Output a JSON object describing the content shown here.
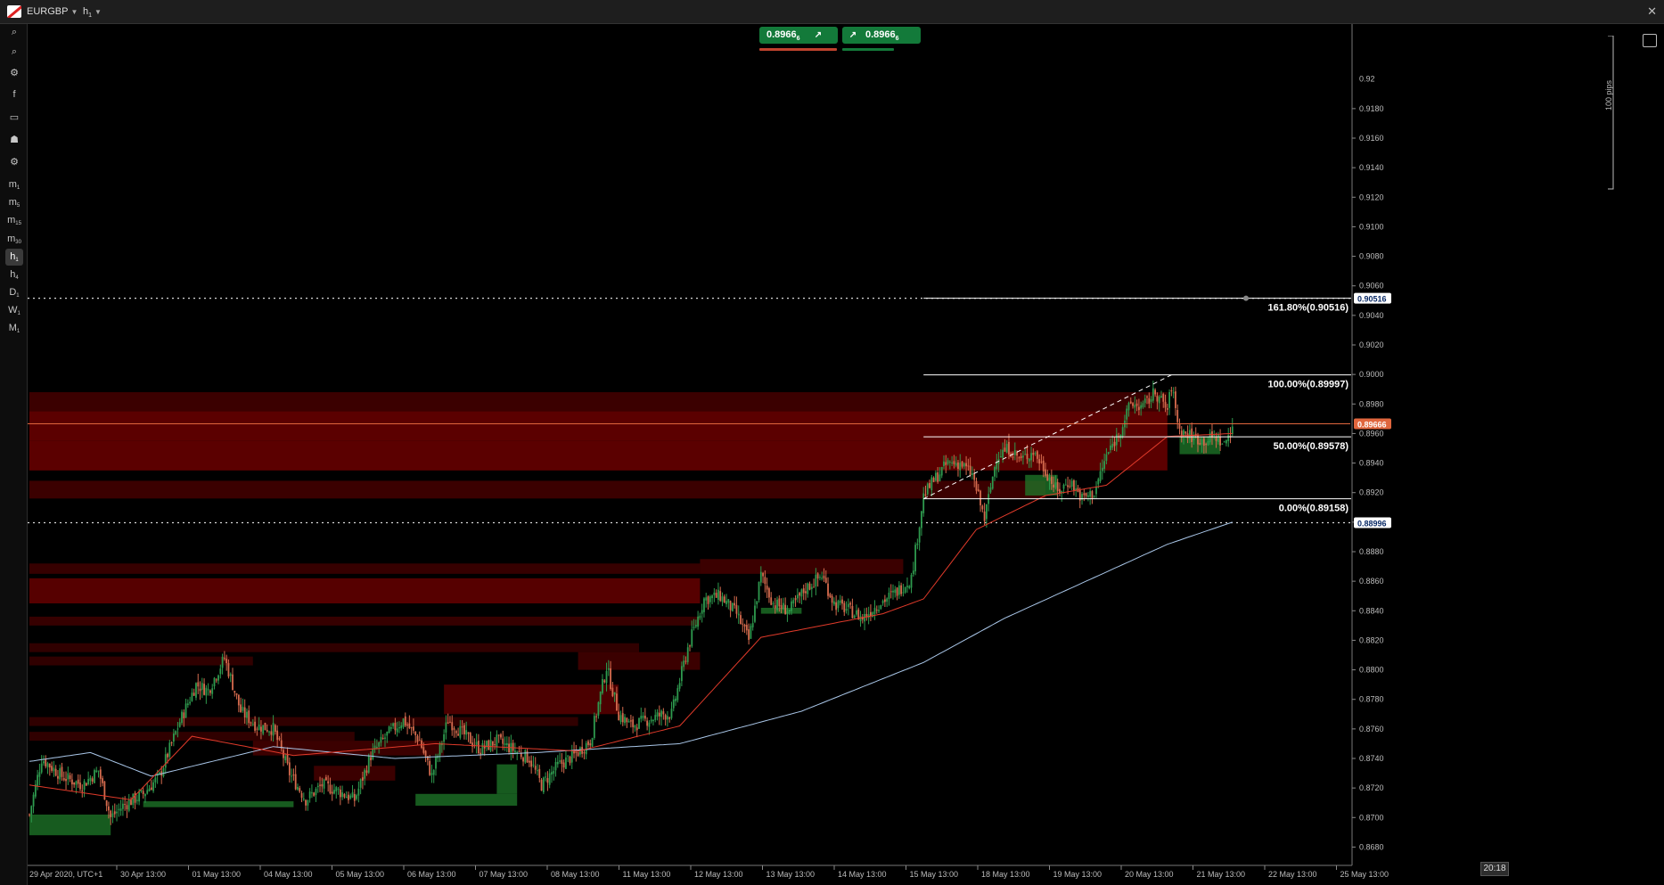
{
  "header": {
    "symbol": "EURGBP",
    "timeframe": "h",
    "timeframe_sub": "1"
  },
  "trade": {
    "sell_price": "0.8966",
    "buy_price": "0.8966",
    "sell_suffix": "6",
    "buy_suffix": "6"
  },
  "toolbar": [
    {
      "name": "zoom-in-icon",
      "label": "⌕",
      "sub": ""
    },
    {
      "name": "zoom-out-icon",
      "label": "⌕",
      "sub": ""
    },
    {
      "name": "indicators-icon",
      "label": "⚙",
      "sub": ""
    },
    {
      "name": "facebook-icon",
      "label": "f",
      "sub": ""
    },
    {
      "name": "chart-type-icon",
      "label": "▭",
      "sub": ""
    },
    {
      "name": "traders-icon",
      "label": "☗",
      "sub": ""
    },
    {
      "name": "settings-icon",
      "label": "⚙",
      "sub": ""
    },
    {
      "name": "tf-m1",
      "label": "m",
      "sub": "1"
    },
    {
      "name": "tf-m5",
      "label": "m",
      "sub": "5"
    },
    {
      "name": "tf-m15",
      "label": "m",
      "sub": "15"
    },
    {
      "name": "tf-m30",
      "label": "m",
      "sub": "30"
    },
    {
      "name": "tf-h1",
      "label": "h",
      "sub": "1",
      "selected": true
    },
    {
      "name": "tf-h4",
      "label": "h",
      "sub": "4"
    },
    {
      "name": "tf-d1",
      "label": "D",
      "sub": "1"
    },
    {
      "name": "tf-w1",
      "label": "W",
      "sub": "1"
    },
    {
      "name": "tf-mn1",
      "label": "M",
      "sub": "1"
    }
  ],
  "time_badge": "20:18",
  "pips_label": "100 pips",
  "colors": {
    "bull": "#2e9a4e",
    "bear": "#d56b4e",
    "ema": "#e03a2a",
    "sma": "#a9c6e8",
    "zone": "#6b0000",
    "accent_green": "#137a3a"
  },
  "chart_data": {
    "type": "candlestick",
    "symbol": "EURGBP",
    "ylim": [
      0.867,
      0.923
    ],
    "y_ticks": [
      "0.9180",
      "0.9160",
      "0.9140",
      "0.9120",
      "0.9100",
      "0.9080",
      "0.9060",
      "0.9040",
      "0.9020",
      "0.9000",
      "0.8980",
      "0.8960",
      "0.8940",
      "0.8920",
      "0.8900",
      "0.8880",
      "0.8860",
      "0.8840",
      "0.8820",
      "0.8800",
      "0.8780",
      "0.8760",
      "0.8740",
      "0.8720",
      "0.8700",
      "0.8680"
    ],
    "y_top_partial": "0.92",
    "x_labels": [
      "29 Apr 2020, UTC+1",
      "30 Apr 13:00",
      "01 May 13:00",
      "04 May 13:00",
      "05 May 13:00",
      "06 May 13:00",
      "07 May 13:00",
      "08 May 13:00",
      "11 May 13:00",
      "12 May 13:00",
      "13 May 13:00",
      "14 May 13:00",
      "15 May 13:00",
      "18 May 13:00",
      "19 May 13:00",
      "20 May 13:00",
      "21 May 13:00",
      "22 May 13:00",
      "25 May 13:00"
    ],
    "close_keypoints": [
      [
        0,
        0.8702
      ],
      [
        6,
        0.874
      ],
      [
        16,
        0.8728
      ],
      [
        26,
        0.8722
      ],
      [
        34,
        0.8732
      ],
      [
        40,
        0.87
      ],
      [
        46,
        0.8708
      ],
      [
        56,
        0.8716
      ],
      [
        64,
        0.8728
      ],
      [
        74,
        0.8765
      ],
      [
        82,
        0.879
      ],
      [
        88,
        0.8786
      ],
      [
        96,
        0.8808
      ],
      [
        104,
        0.8772
      ],
      [
        112,
        0.8762
      ],
      [
        120,
        0.876
      ],
      [
        128,
        0.873
      ],
      [
        136,
        0.8712
      ],
      [
        144,
        0.8722
      ],
      [
        152,
        0.8718
      ],
      [
        160,
        0.8712
      ],
      [
        168,
        0.8742
      ],
      [
        176,
        0.8756
      ],
      [
        184,
        0.8766
      ],
      [
        192,
        0.8752
      ],
      [
        198,
        0.8728
      ],
      [
        206,
        0.8766
      ],
      [
        214,
        0.8756
      ],
      [
        222,
        0.8746
      ],
      [
        230,
        0.8752
      ],
      [
        238,
        0.8746
      ],
      [
        246,
        0.874
      ],
      [
        252,
        0.8722
      ],
      [
        260,
        0.8735
      ],
      [
        268,
        0.8742
      ],
      [
        276,
        0.8752
      ],
      [
        284,
        0.8802
      ],
      [
        290,
        0.877
      ],
      [
        296,
        0.8762
      ],
      [
        304,
        0.8766
      ],
      [
        312,
        0.877
      ],
      [
        316,
        0.877
      ],
      [
        324,
        0.8815
      ],
      [
        332,
        0.8848
      ],
      [
        340,
        0.885
      ],
      [
        348,
        0.8838
      ],
      [
        354,
        0.882
      ],
      [
        360,
        0.8864
      ],
      [
        366,
        0.8845
      ],
      [
        374,
        0.884
      ],
      [
        382,
        0.8855
      ],
      [
        390,
        0.8864
      ],
      [
        396,
        0.8845
      ],
      [
        404,
        0.884
      ],
      [
        410,
        0.8835
      ],
      [
        418,
        0.8845
      ],
      [
        426,
        0.8852
      ],
      [
        434,
        0.8862
      ],
      [
        440,
        0.8918
      ],
      [
        446,
        0.893
      ],
      [
        452,
        0.894
      ],
      [
        458,
        0.894
      ],
      [
        464,
        0.8932
      ],
      [
        470,
        0.8902
      ],
      [
        476,
        0.8945
      ],
      [
        482,
        0.895
      ],
      [
        488,
        0.8942
      ],
      [
        494,
        0.8948
      ],
      [
        500,
        0.8935
      ],
      [
        506,
        0.892
      ],
      [
        512,
        0.8928
      ],
      [
        518,
        0.8916
      ],
      [
        524,
        0.892
      ],
      [
        530,
        0.8945
      ],
      [
        536,
        0.896
      ],
      [
        542,
        0.898
      ],
      [
        548,
        0.8978
      ],
      [
        554,
        0.8988
      ],
      [
        560,
        0.8976
      ],
      [
        562,
        0.8992
      ],
      [
        566,
        0.8962
      ],
      [
        572,
        0.8958
      ],
      [
        578,
        0.8955
      ],
      [
        584,
        0.8958
      ],
      [
        588,
        0.8952
      ],
      [
        592,
        0.8966
      ]
    ],
    "ema_keypoints": [
      [
        0,
        0.8722
      ],
      [
        50,
        0.8712
      ],
      [
        80,
        0.8755
      ],
      [
        130,
        0.8742
      ],
      [
        200,
        0.875
      ],
      [
        270,
        0.8745
      ],
      [
        320,
        0.8762
      ],
      [
        360,
        0.8822
      ],
      [
        420,
        0.8838
      ],
      [
        440,
        0.8848
      ],
      [
        466,
        0.8895
      ],
      [
        500,
        0.8918
      ],
      [
        530,
        0.8925
      ],
      [
        560,
        0.8958
      ],
      [
        592,
        0.896
      ]
    ],
    "sma_keypoints": [
      [
        0,
        0.8738
      ],
      [
        30,
        0.8744
      ],
      [
        60,
        0.8728
      ],
      [
        120,
        0.8748
      ],
      [
        180,
        0.874
      ],
      [
        250,
        0.8744
      ],
      [
        320,
        0.875
      ],
      [
        380,
        0.8772
      ],
      [
        440,
        0.8805
      ],
      [
        480,
        0.8835
      ],
      [
        520,
        0.886
      ],
      [
        560,
        0.8885
      ],
      [
        592,
        0.89
      ]
    ],
    "zones": [
      {
        "y0": 0.8975,
        "y1": 0.8988,
        "x0": 0,
        "x1": 560,
        "a": 0.55
      },
      {
        "y0": 0.8955,
        "y1": 0.8975,
        "x0": 0,
        "x1": 560,
        "a": 0.85
      },
      {
        "y0": 0.8935,
        "y1": 0.8955,
        "x0": 0,
        "x1": 560,
        "a": 0.85
      },
      {
        "y0": 0.8916,
        "y1": 0.8928,
        "x0": 0,
        "x1": 500,
        "a": 0.55
      },
      {
        "y0": 0.8865,
        "y1": 0.8872,
        "x0": 0,
        "x1": 330,
        "a": 0.5
      },
      {
        "y0": 0.8845,
        "y1": 0.8862,
        "x0": 0,
        "x1": 330,
        "a": 0.8
      },
      {
        "y0": 0.883,
        "y1": 0.8836,
        "x0": 0,
        "x1": 330,
        "a": 0.5
      },
      {
        "y0": 0.8812,
        "y1": 0.8818,
        "x0": 0,
        "x1": 300,
        "a": 0.45
      },
      {
        "y0": 0.8803,
        "y1": 0.8809,
        "x0": 0,
        "x1": 110,
        "a": 0.45
      },
      {
        "y0": 0.877,
        "y1": 0.879,
        "x0": 204,
        "x1": 290,
        "a": 0.7
      },
      {
        "y0": 0.8762,
        "y1": 0.8768,
        "x0": 0,
        "x1": 270,
        "a": 0.45
      },
      {
        "y0": 0.8752,
        "y1": 0.8758,
        "x0": 0,
        "x1": 160,
        "a": 0.45
      },
      {
        "y0": 0.8742,
        "y1": 0.8752,
        "x0": 110,
        "x1": 204,
        "a": 0.55
      },
      {
        "y0": 0.8865,
        "y1": 0.8875,
        "x0": 330,
        "x1": 430,
        "a": 0.55
      },
      {
        "y0": 0.88,
        "y1": 0.8812,
        "x0": 270,
        "x1": 330,
        "a": 0.55
      },
      {
        "y0": 0.8725,
        "y1": 0.8735,
        "x0": 140,
        "x1": 180,
        "a": 0.55
      }
    ],
    "green_zones": [
      {
        "y0": 0.8688,
        "y1": 0.8702,
        "x0": 0,
        "x1": 40
      },
      {
        "y0": 0.8707,
        "y1": 0.8711,
        "x0": 56,
        "x1": 130
      },
      {
        "y0": 0.8708,
        "y1": 0.8716,
        "x0": 190,
        "x1": 240
      },
      {
        "y0": 0.8716,
        "y1": 0.8736,
        "x0": 230,
        "x1": 240
      },
      {
        "y0": 0.8838,
        "y1": 0.8842,
        "x0": 360,
        "x1": 380
      },
      {
        "y0": 0.8918,
        "y1": 0.8932,
        "x0": 490,
        "x1": 506
      },
      {
        "y0": 0.8946,
        "y1": 0.8958,
        "x0": 566,
        "x1": 586
      }
    ],
    "fibonacci": [
      {
        "label": "161.80%(0.90516)",
        "price": 0.90516
      },
      {
        "label": "100.00%(0.89997)",
        "price": 0.89997
      },
      {
        "label": "50.00%(0.89578)",
        "price": 0.89578
      },
      {
        "label": "0.00%(0.89158)",
        "price": 0.89158
      }
    ],
    "dotted_lines": [
      {
        "price": 0.90516,
        "tag": "0.90516"
      },
      {
        "price": 0.88996,
        "tag": "0.88996"
      }
    ],
    "current_price": {
      "price": 0.89666,
      "tag": "0.89666"
    }
  }
}
